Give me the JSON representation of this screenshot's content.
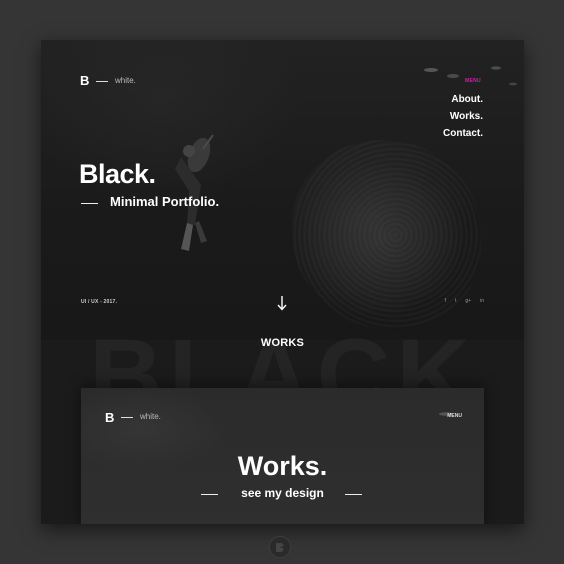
{
  "hero": {
    "logo_letter": "B",
    "logo_word": "white.",
    "menu_label": "MENU",
    "nav": [
      {
        "label": "About."
      },
      {
        "label": "Works."
      },
      {
        "label": "Contact."
      }
    ],
    "headline": "Black.",
    "subhead": "Minimal Portfolio.",
    "meta": "UI / UX  - 2017.",
    "socials": [
      "f",
      "t",
      "g+",
      "in"
    ]
  },
  "background_word": "BLACK",
  "works_section": {
    "title": "WORKS"
  },
  "card": {
    "logo_letter": "B",
    "logo_word": "white.",
    "menu_label": "MENU",
    "title": "Works.",
    "subtitle": "see my design"
  },
  "colors": {
    "accent": "#d21fb5",
    "background": "#353535",
    "board": "#1b1b1b"
  },
  "icons": [
    "down-arrow-icon",
    "diver-image",
    "brand-mark-icon"
  ]
}
